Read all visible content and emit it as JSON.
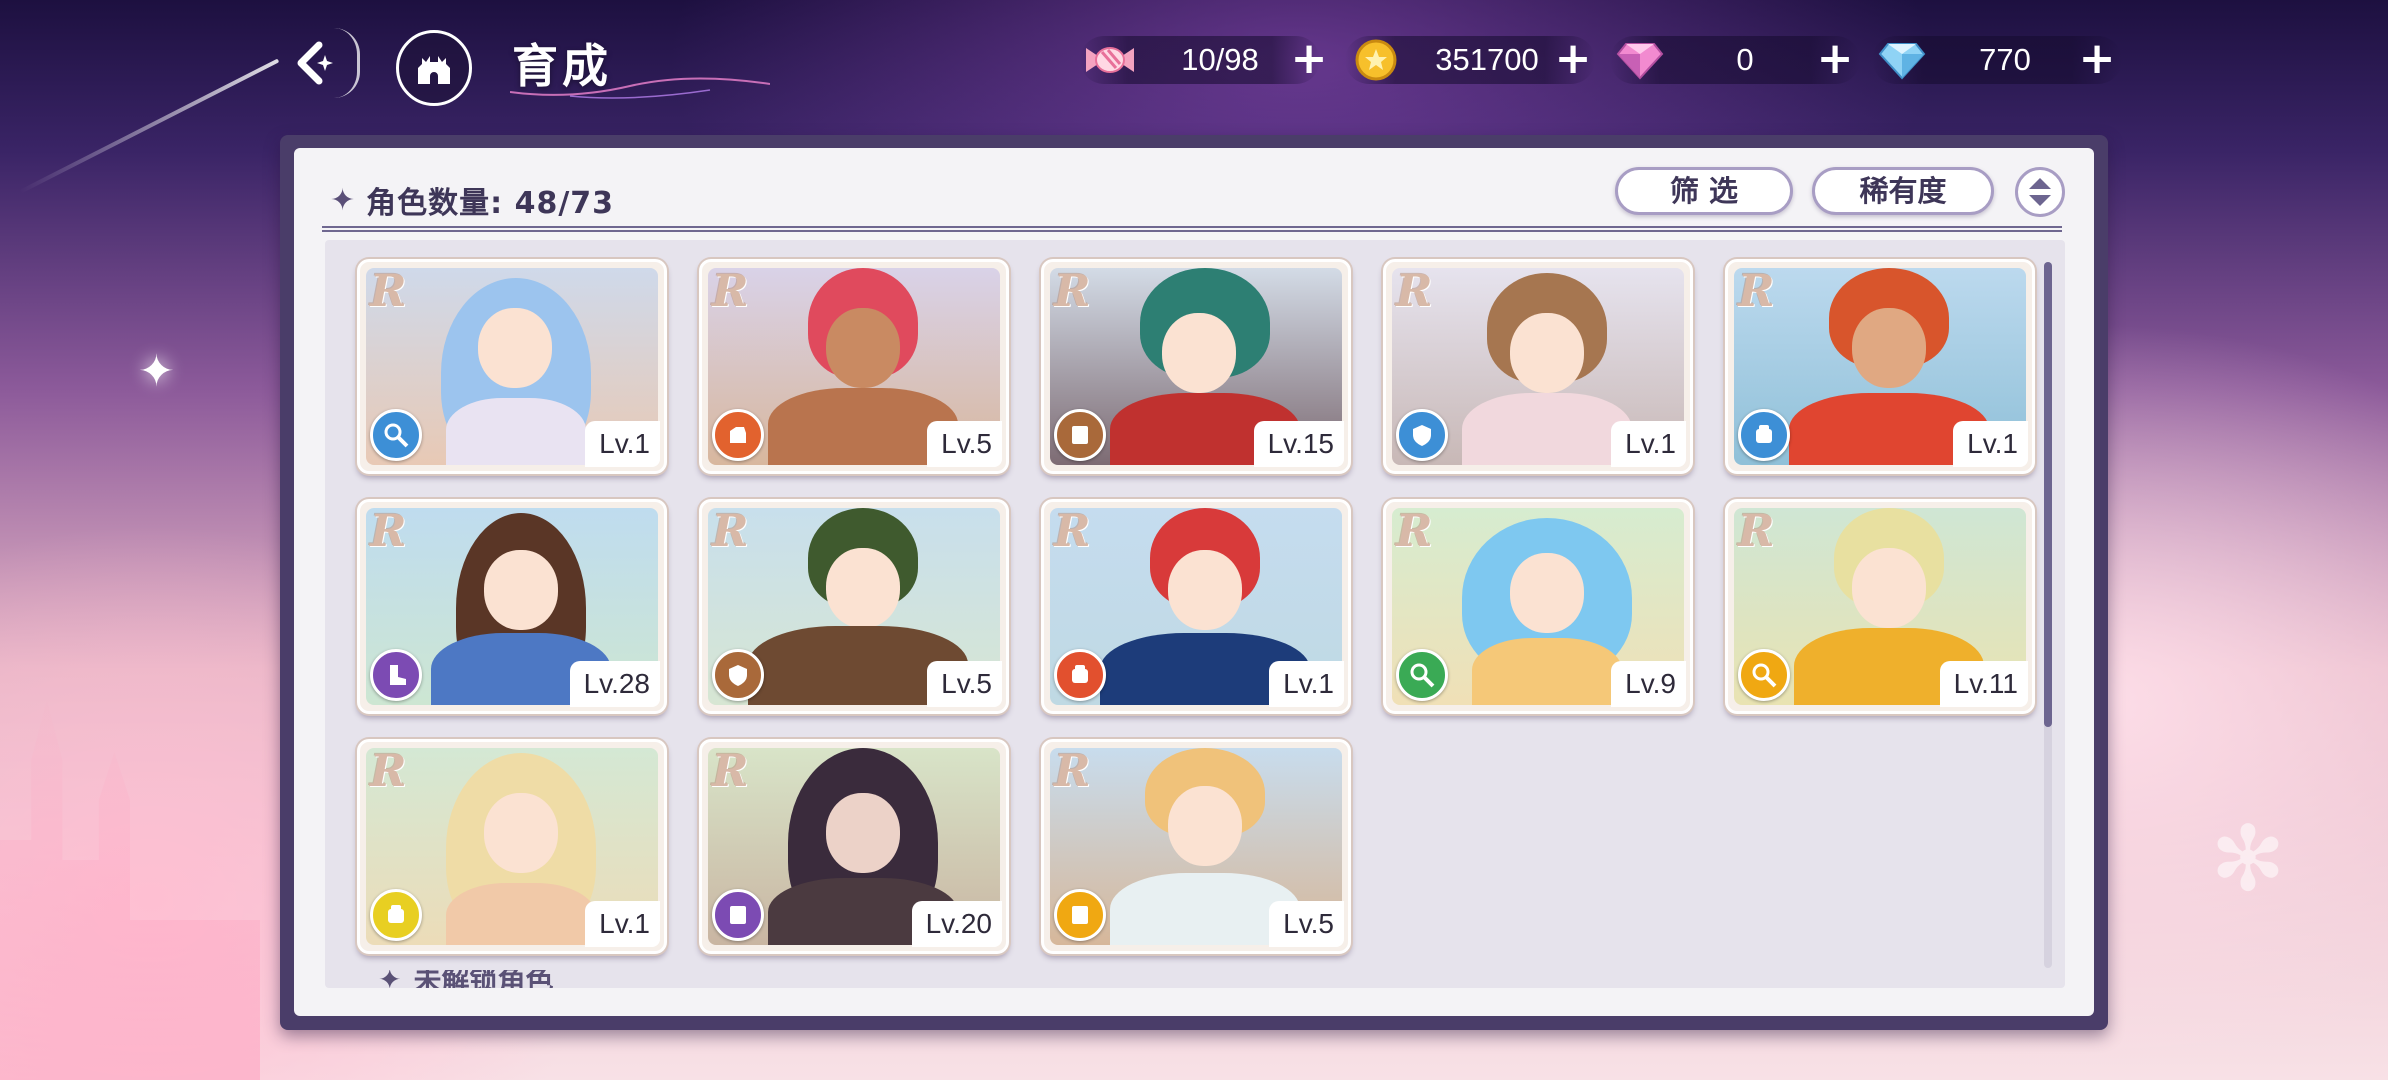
{
  "header": {
    "title": "育成"
  },
  "currencies": [
    {
      "icon": "candy-icon",
      "value": "10/98"
    },
    {
      "icon": "gold-coin-icon",
      "value": "351700"
    },
    {
      "icon": "pink-gem-icon",
      "value": "0"
    },
    {
      "icon": "blue-diamond-icon",
      "value": "770"
    }
  ],
  "toolbar": {
    "count_label": "角色数量: 48/73",
    "filter_label": "筛 选",
    "sort_label": "稀有度"
  },
  "characters": [
    {
      "rarity": "R",
      "level": "Lv.1",
      "role_color": "#3d8fd6"
    },
    {
      "rarity": "R",
      "level": "Lv.5",
      "role_color": "#e2622e"
    },
    {
      "rarity": "R",
      "level": "Lv.15",
      "role_color": "#a9693a"
    },
    {
      "rarity": "R",
      "level": "Lv.1",
      "role_color": "#3d8fd6"
    },
    {
      "rarity": "R",
      "level": "Lv.1",
      "role_color": "#3d8fd6"
    },
    {
      "rarity": "R",
      "level": "Lv.28",
      "role_color": "#7c4bb3"
    },
    {
      "rarity": "R",
      "level": "Lv.5",
      "role_color": "#a9693a"
    },
    {
      "rarity": "R",
      "level": "Lv.1",
      "role_color": "#e2502e"
    },
    {
      "rarity": "R",
      "level": "Lv.9",
      "role_color": "#3aaa55"
    },
    {
      "rarity": "R",
      "level": "Lv.11",
      "role_color": "#f0a812"
    },
    {
      "rarity": "R",
      "level": "Lv.1",
      "role_color": "#e8cf22"
    },
    {
      "rarity": "R",
      "level": "Lv.20",
      "role_color": "#7c4bb3"
    },
    {
      "rarity": "R",
      "level": "Lv.5",
      "role_color": "#f0a812"
    }
  ],
  "locked_section": {
    "label": "未解锁角色"
  }
}
